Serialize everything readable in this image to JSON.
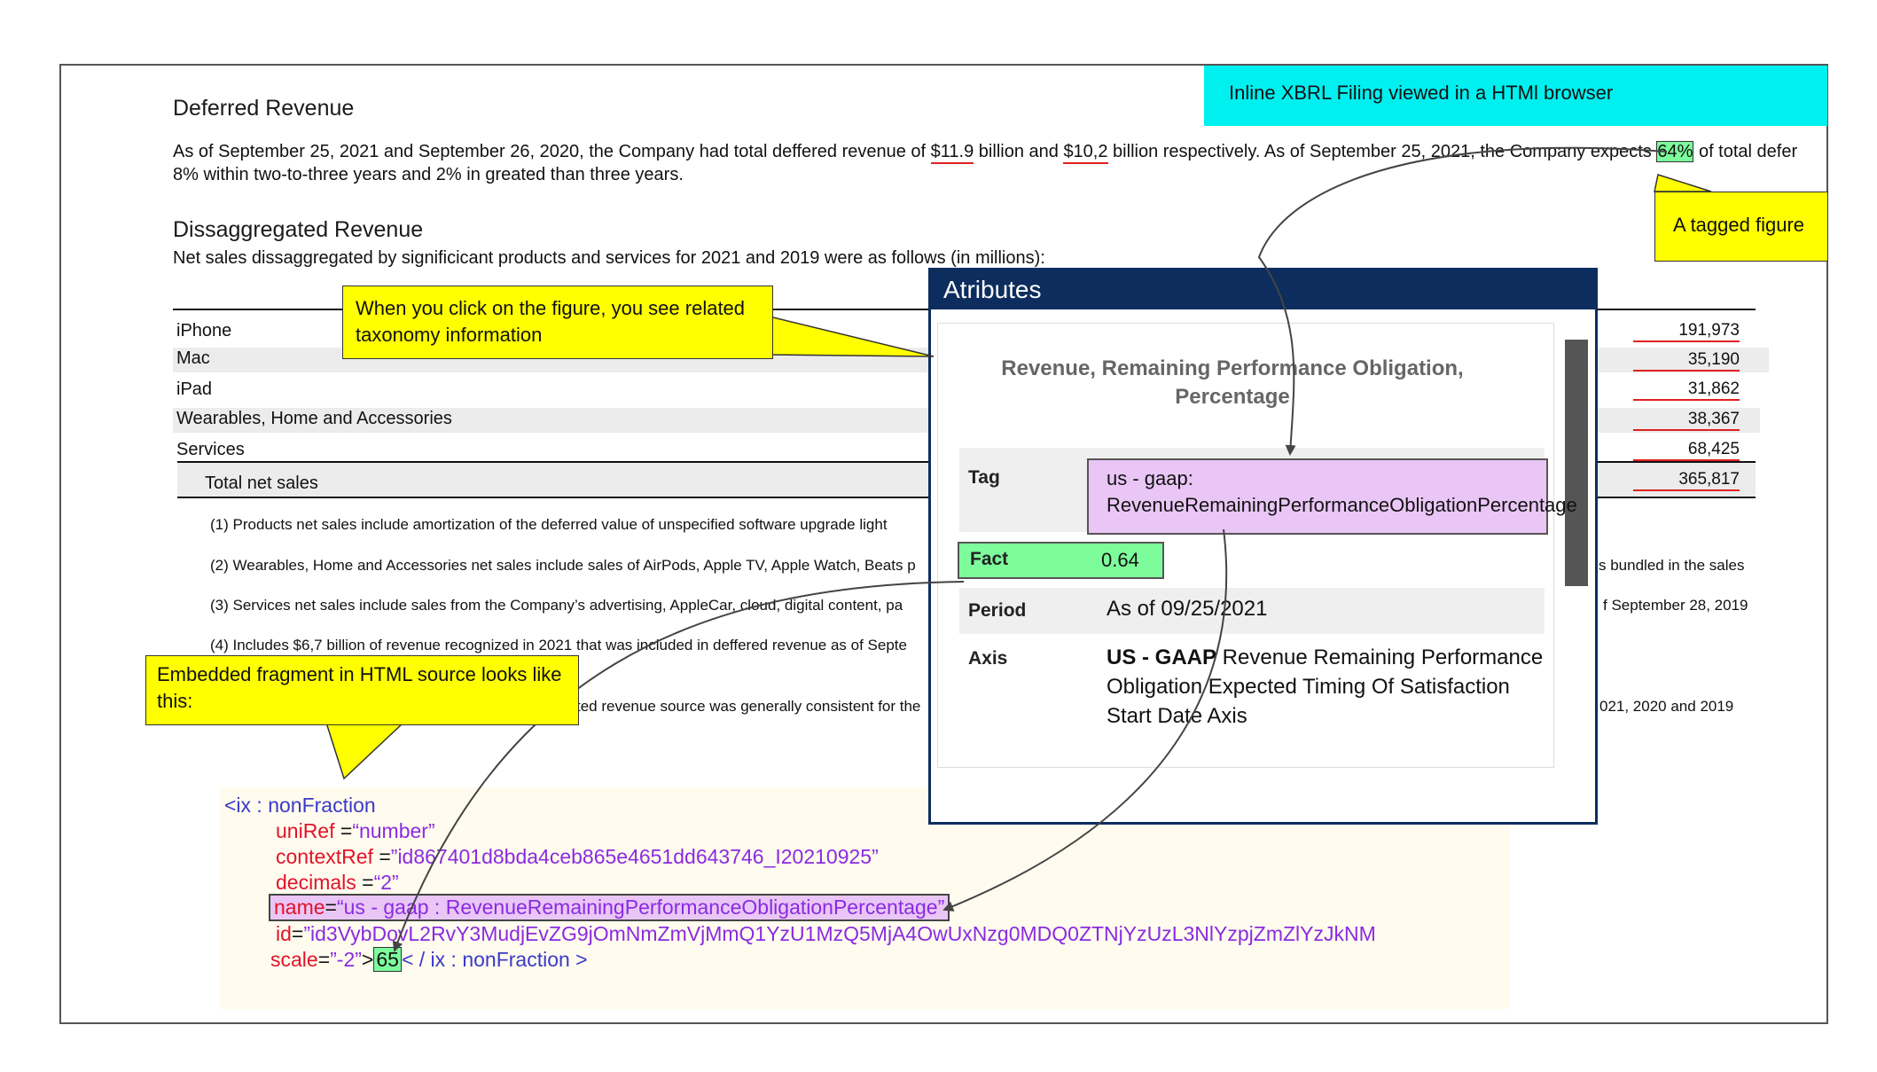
{
  "banner": "Inline XBRL Filing viewed in a HTMl browser",
  "deferred": {
    "title": "Deferred Revenue",
    "line1_a": "As of September 25, 2021 and September 26, 2020, the Company had total deffered revenue of ",
    "v1": "$11.9",
    "line1_b": " billion and ",
    "v2": "$10,2",
    "line1_c": " billion respectively. As of September 25, 2021, the Company expects ",
    "v3": "64%",
    "line1_d": " of total defer",
    "line2": "8% within two-to-three years and 2% in greated than three years."
  },
  "disagg": {
    "title": "Dissaggregated Revenue",
    "subtitle": "Net sales dissaggregated by significicant products and services for 2021 and 2019 were as follows (in millions):"
  },
  "table": {
    "rows": [
      {
        "label": "iPhone",
        "value": "191,973"
      },
      {
        "label": "Mac",
        "value": "35,190"
      },
      {
        "label": "iPad",
        "value": "31,862"
      },
      {
        "label": "Wearables, Home and Accessories",
        "value": "38,367"
      },
      {
        "label": "Services",
        "value": "68,425"
      }
    ],
    "total_label": "Total net sales",
    "total_value": "365,817"
  },
  "notes": {
    "n1": "(1)  Products net sales include amortization of the deferred value of unspecified software upgrade light",
    "n2": "(2)   Wearables, Home and Accessories net sales include sales of AirPods, Apple TV, Apple Watch, Beats p",
    "n2_tail": "s bundled in the sales",
    "n3": "(3)   Services net sales include sales from the Company’s advertising, AppleCar, cloud, digital content, pa",
    "n3_tail": "f September 28, 2019",
    "n4": "(4) Includes $6,7 billion of revenue recognized in 2021 that was included in deffered revenue as of Septe",
    "n5": "ted revenue source was generally consistent for the",
    "n5_tail": "021, 2020 and 2019"
  },
  "callouts": {
    "tagged": "A tagged figure",
    "click": "When you click on the figure, you see related taxonomy information",
    "embedded": "Embedded fragment in HTML source looks like this:"
  },
  "popup": {
    "header": "Atributes",
    "title": "Revenue, Remaining Performance Obligation, Percentage",
    "tag_label": "Tag",
    "tag_value": "us - gaap: RevenueRemainingPerformanceObligationPercentage",
    "fact_label": "Fact",
    "fact_value": "0.64",
    "period_label": "Period",
    "period_value": "As of 09/25/2021",
    "axis_label": "Axis",
    "axis_bold": "US - GAAP",
    "axis_rest": " Revenue Remaining Performance Obligation Expected Timing Of Satisfaction Start Date Axis"
  },
  "code": {
    "open": "<ix : nonFraction",
    "uniref_attr": "uniRef",
    "uniref_eq": " =",
    "uniref_val": "“number”",
    "context_attr": "contextRef",
    "context_eq": " =",
    "context_val": "”id867401d8bda4ceb865e4651dd643746_I20210925”",
    "decimals_attr": "decimals",
    "decimals_eq": " =",
    "decimals_val": "“2”",
    "name_attr": "name",
    "name_eq": "=",
    "name_val": "“us - gaap : RevenueRemainingPerformanceObligationPercentage”",
    "id_attr": "id",
    "id_eq": "=",
    "id_val": "”id3VybDovL2RvY3MudjEvZG9jOmNmZmVjMmQ1YzU1MzQ5MjA4OwUxNzg0MDQ0ZTNjYzUzL3NlYzpjZmZlYzJkNM",
    "scale_attr": "scale",
    "scale_eq": "=",
    "scale_val": "”-2”",
    "gt": ">",
    "value": "65",
    "close": "< / ix : nonFraction >"
  },
  "colors": {
    "banner": "#00f0f0",
    "callout": "#ffff00",
    "popup_header": "#0d2d5e",
    "tag_box": "#e9c6f5",
    "fact_box": "#7dfc9c",
    "code_element": "#3a3ac8",
    "code_attr": "#e0142a",
    "code_value": "#8a2be2",
    "underline": "#e02020"
  }
}
